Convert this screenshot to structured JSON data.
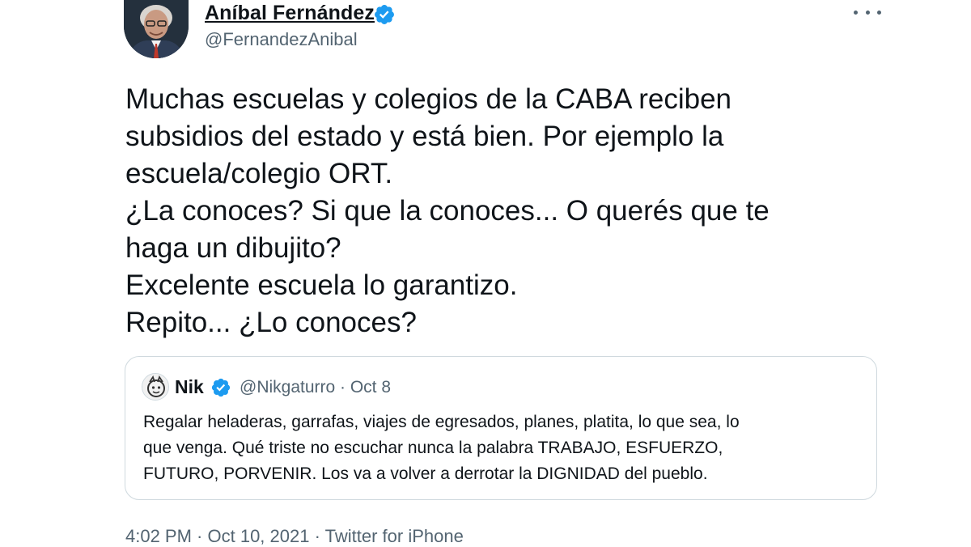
{
  "author": {
    "name": "Aníbal Fernández",
    "handle": "@FernandezAnibal",
    "verified": true
  },
  "tweet": {
    "lines": [
      "Muchas escuelas y colegios de la CABA reciben",
      "subsidios del estado y está bien. Por ejemplo la",
      "escuela/colegio ORT.",
      "¿La conoces? Si que la conoces... O querés que te",
      "haga un dibujito?",
      "Excelente escuela lo garantizo.",
      "Repito... ¿Lo conoces?"
    ]
  },
  "quoted": {
    "name": "Nik",
    "verified": true,
    "meta": "@Nikgaturro · Oct 8",
    "lines": [
      "Regalar heladeras, garrafas, viajes de egresados, planes, platita, lo que sea, lo",
      "que venga. Qué triste no escuchar nunca la palabra TRABAJO, ESFUERZO,",
      "FUTURO, PORVENIR. Los va a volver a derrotar la DIGNIDAD del pueblo."
    ]
  },
  "footer": {
    "time": "4:02 PM",
    "separator": " · ",
    "date": "Oct 10, 2021",
    "source": "Twitter for iPhone"
  },
  "icons": {
    "verified": "verified-badge-icon",
    "more": "more-dots-icon"
  },
  "colors": {
    "verified": "#1d9bf0",
    "text": "#0f1419",
    "secondary": "#536471",
    "border": "#cfd9de"
  }
}
